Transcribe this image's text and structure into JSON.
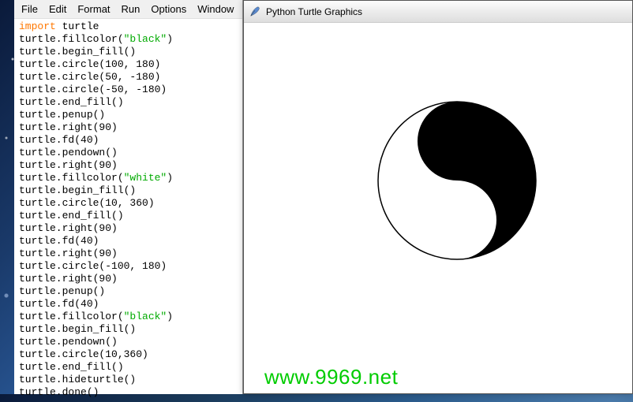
{
  "menubar": {
    "items": [
      "File",
      "Edit",
      "Format",
      "Run",
      "Options",
      "Window"
    ]
  },
  "code": {
    "lines": [
      {
        "segs": [
          {
            "t": "import",
            "c": "kw"
          },
          {
            "t": " turtle"
          }
        ]
      },
      {
        "segs": [
          {
            "t": "turtle.fillcolor("
          },
          {
            "t": "\"black\"",
            "c": "str"
          },
          {
            "t": ")"
          }
        ]
      },
      {
        "segs": [
          {
            "t": "turtle.begin_fill()"
          }
        ]
      },
      {
        "segs": [
          {
            "t": "turtle.circle(100, 180)"
          }
        ]
      },
      {
        "segs": [
          {
            "t": "turtle.circle(50, -180)"
          }
        ]
      },
      {
        "segs": [
          {
            "t": "turtle.circle(-50, -180)"
          }
        ]
      },
      {
        "segs": [
          {
            "t": "turtle.end_fill()"
          }
        ]
      },
      {
        "segs": [
          {
            "t": "turtle.penup()"
          }
        ]
      },
      {
        "segs": [
          {
            "t": "turtle.right(90)"
          }
        ]
      },
      {
        "segs": [
          {
            "t": "turtle.fd(40)"
          }
        ]
      },
      {
        "segs": [
          {
            "t": "turtle.pendown()"
          }
        ]
      },
      {
        "segs": [
          {
            "t": "turtle.right(90)"
          }
        ]
      },
      {
        "segs": [
          {
            "t": "turtle.fillcolor("
          },
          {
            "t": "\"white\"",
            "c": "str"
          },
          {
            "t": ")"
          }
        ]
      },
      {
        "segs": [
          {
            "t": "turtle.begin_fill()"
          }
        ]
      },
      {
        "segs": [
          {
            "t": "turtle.circle(10, 360)"
          }
        ]
      },
      {
        "segs": [
          {
            "t": "turtle.end_fill()"
          }
        ]
      },
      {
        "segs": [
          {
            "t": "turtle.right(90)"
          }
        ]
      },
      {
        "segs": [
          {
            "t": "turtle.fd(40)"
          }
        ]
      },
      {
        "segs": [
          {
            "t": "turtle.right(90)"
          }
        ]
      },
      {
        "segs": [
          {
            "t": "turtle.circle(-100, 180)"
          }
        ]
      },
      {
        "segs": [
          {
            "t": "turtle.right(90)"
          }
        ]
      },
      {
        "segs": [
          {
            "t": "turtle.penup()"
          }
        ]
      },
      {
        "segs": [
          {
            "t": "turtle.fd(40)"
          }
        ]
      },
      {
        "segs": [
          {
            "t": "turtle.fillcolor("
          },
          {
            "t": "\"black\"",
            "c": "str"
          },
          {
            "t": ")"
          }
        ]
      },
      {
        "segs": [
          {
            "t": "turtle.begin_fill()"
          }
        ]
      },
      {
        "segs": [
          {
            "t": "turtle.pendown()"
          }
        ]
      },
      {
        "segs": [
          {
            "t": "turtle.circle(10,360)"
          }
        ]
      },
      {
        "segs": [
          {
            "t": "turtle.end_fill()"
          }
        ]
      },
      {
        "segs": [
          {
            "t": "turtle.hideturtle()"
          }
        ]
      },
      {
        "segs": [
          {
            "t": "turtle.done()"
          }
        ]
      }
    ]
  },
  "turtle_window": {
    "title": "Python Turtle Graphics"
  },
  "watermark": "www.9969.net"
}
